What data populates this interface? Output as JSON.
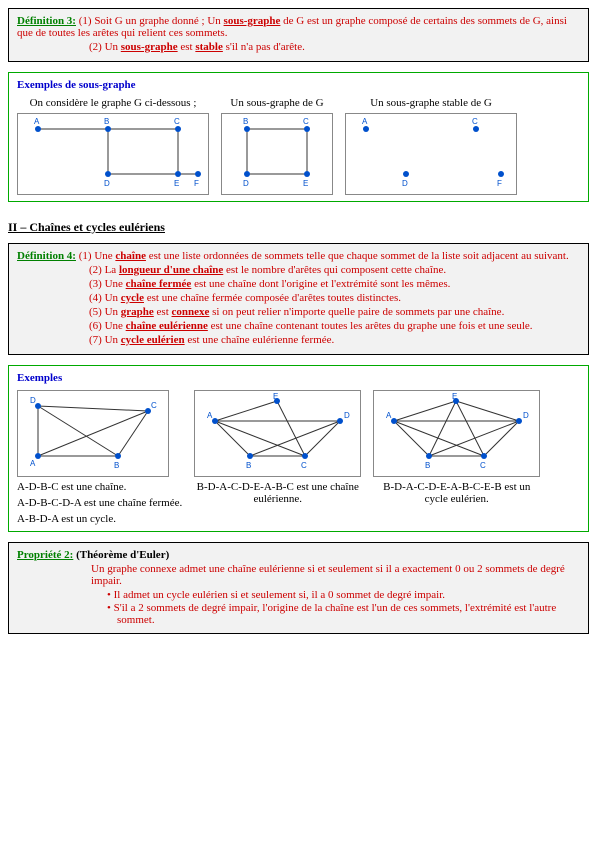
{
  "def3": {
    "label": "Définition 3:",
    "p1_num": "(1)",
    "p1_a": "Soit G un graphe donné ; Un ",
    "p1_term": "sous-graphe",
    "p1_b": " de G est un graphe composé de certains des sommets de G, ainsi que de toutes les arêtes qui relient ces sommets.",
    "p2_num": "(2)",
    "p2_a": "Un ",
    "p2_term": "sous-graphe",
    "p2_b": " est ",
    "p2_term2": "stable",
    "p2_c": " s'il n'a pas d'arête."
  },
  "ex1": {
    "title": "Exemples de sous-graphe",
    "cap_intro": "On considère le graphe G ci-dessous ;",
    "cap_sub": "Un sous-graphe de G",
    "cap_stable": "Un sous-graphe stable de G"
  },
  "section2": "II – Chaînes et cycles eulériens",
  "def4": {
    "label": "Définition 4:",
    "p1_num": "(1)",
    "p1_a": "Une ",
    "p1_term": "chaîne",
    "p1_b": " est une liste ordonnées de sommets telle que chaque sommet de la liste soit adjacent au suivant.",
    "p2_num": "(2)",
    "p2_a": "La ",
    "p2_term": "longueur d'une chaîne",
    "p2_b": " est le nombre d'arêtes qui composent cette chaîne.",
    "p3_num": "(3)",
    "p3_a": "Une ",
    "p3_term": "chaîne fermée",
    "p3_b": " est une chaîne dont l'origine et l'extrémité sont les mêmes.",
    "p4_num": "(4)",
    "p4_a": "Un ",
    "p4_term": "cycle",
    "p4_b": " est une chaîne fermée composée d'arêtes toutes distinctes.",
    "p5_num": "(5)",
    "p5_a": "Un ",
    "p5_term": "graphe",
    "p5_b": " est ",
    "p5_term2": "connexe",
    "p5_c": " si on peut relier n'importe quelle paire de sommets par une chaîne.",
    "p6_num": "(6)",
    "p6_a": "Une ",
    "p6_term": "chaîne eulérienne",
    "p6_b": " est une chaîne contenant toutes les arêtes du graphe une fois et une seule.",
    "p7_num": "(7)",
    "p7_a": "Un ",
    "p7_term": "cycle eulérien",
    "p7_b": " est une chaîne eulérienne fermée."
  },
  "ex2": {
    "title": "Exemples",
    "g1_l1": "A-D-B-C est une chaîne.",
    "g1_l2": "A-D-B-C-D-A est une chaîne fermée.",
    "g1_l3": "A-B-D-A est un cycle.",
    "g2_l1": "B-D-A-C-D-E-A-B-C est une chaîne eulérienne.",
    "g3_l1": "B-D-A-C-D-E-A-B-C-E-B est un cycle eulérien."
  },
  "prop2": {
    "label": "Propriété 2:",
    "title": "(Théorème d'Euler)",
    "main": "Un graphe connexe admet une chaîne eulérienne si et seulement si il a exactement 0 ou 2 sommets de degré impair.",
    "b1": "Il admet un cycle eulérien si et seulement si, il a 0 sommet de degré impair.",
    "b2": "S'il a 2 sommets de degré impair, l'origine de la chaîne est l'un de ces sommets, l'extrémité est l'autre sommet."
  }
}
